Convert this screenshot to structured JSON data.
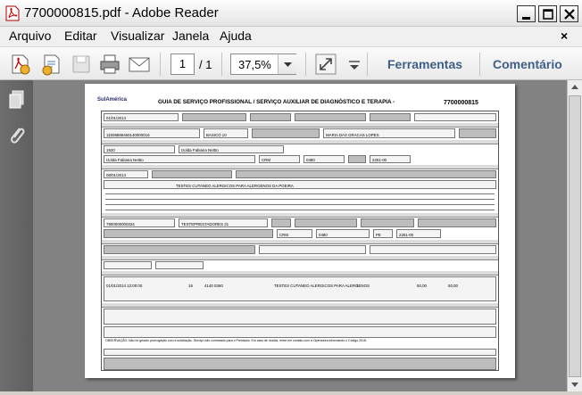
{
  "window": {
    "title": "7700000815.pdf - Adobe Reader",
    "close_x": "×"
  },
  "menu": {
    "items": [
      "Arquivo",
      "Editar",
      "Visualizar",
      "Janela",
      "Ajuda"
    ]
  },
  "toolbar": {
    "page_current": "1",
    "page_total": "/ 1",
    "zoom": "37,5%",
    "tools_label": "Ferramentas",
    "comment_label": "Comentário"
  },
  "form": {
    "logo": "SulAmérica",
    "title": "GUIA DE SERVIÇO PROFISSIONAL / SERVIÇO AUXILIAR DE DIAGNÓSTICO E TERAPIA -",
    "number": "7700000815",
    "date_value": "01/01/2014",
    "card_value": "11508886460140000016",
    "plan_value": "BASICO 10",
    "beneficiary_name": "MARIA DAS GRACAS LOPES",
    "requester_code": "1920",
    "requester_name": "Izolda Fabiana Nettto",
    "requester_prof": "Izolda Fabiana Nettto",
    "council": "CRM",
    "council_number": "0480",
    "cbo": "2251-00",
    "request_date": "08/01/2014",
    "procedure_desc": "TESTES CUTANEO ALERGICOS PARA ALERGENOS DA POEIRA",
    "executor_code": "7900000000324",
    "executor_name": "TESTEPRESTADORES 21",
    "exec_council": "CRM",
    "exec_council_number": "0480",
    "exec_state": "PE",
    "exec_cbo": "2251-00",
    "exec_date": "01/01/2014 12:00:00",
    "table_code": "16",
    "proc_code": "4140 0360",
    "proc_desc": "TESTES CUTANEO ALERGICOS PARA ALERGENOS",
    "qty": "1",
    "value_unit": "50,00",
    "value_total": "50,00",
    "footer_note": "OBSERVAÇÃO: Não foi gerado prorrogação com a solicitação. Serviço não contratado para o Prestador. Em caso de dúvida, entre em contato com a Operadora informando o Código 2018."
  }
}
